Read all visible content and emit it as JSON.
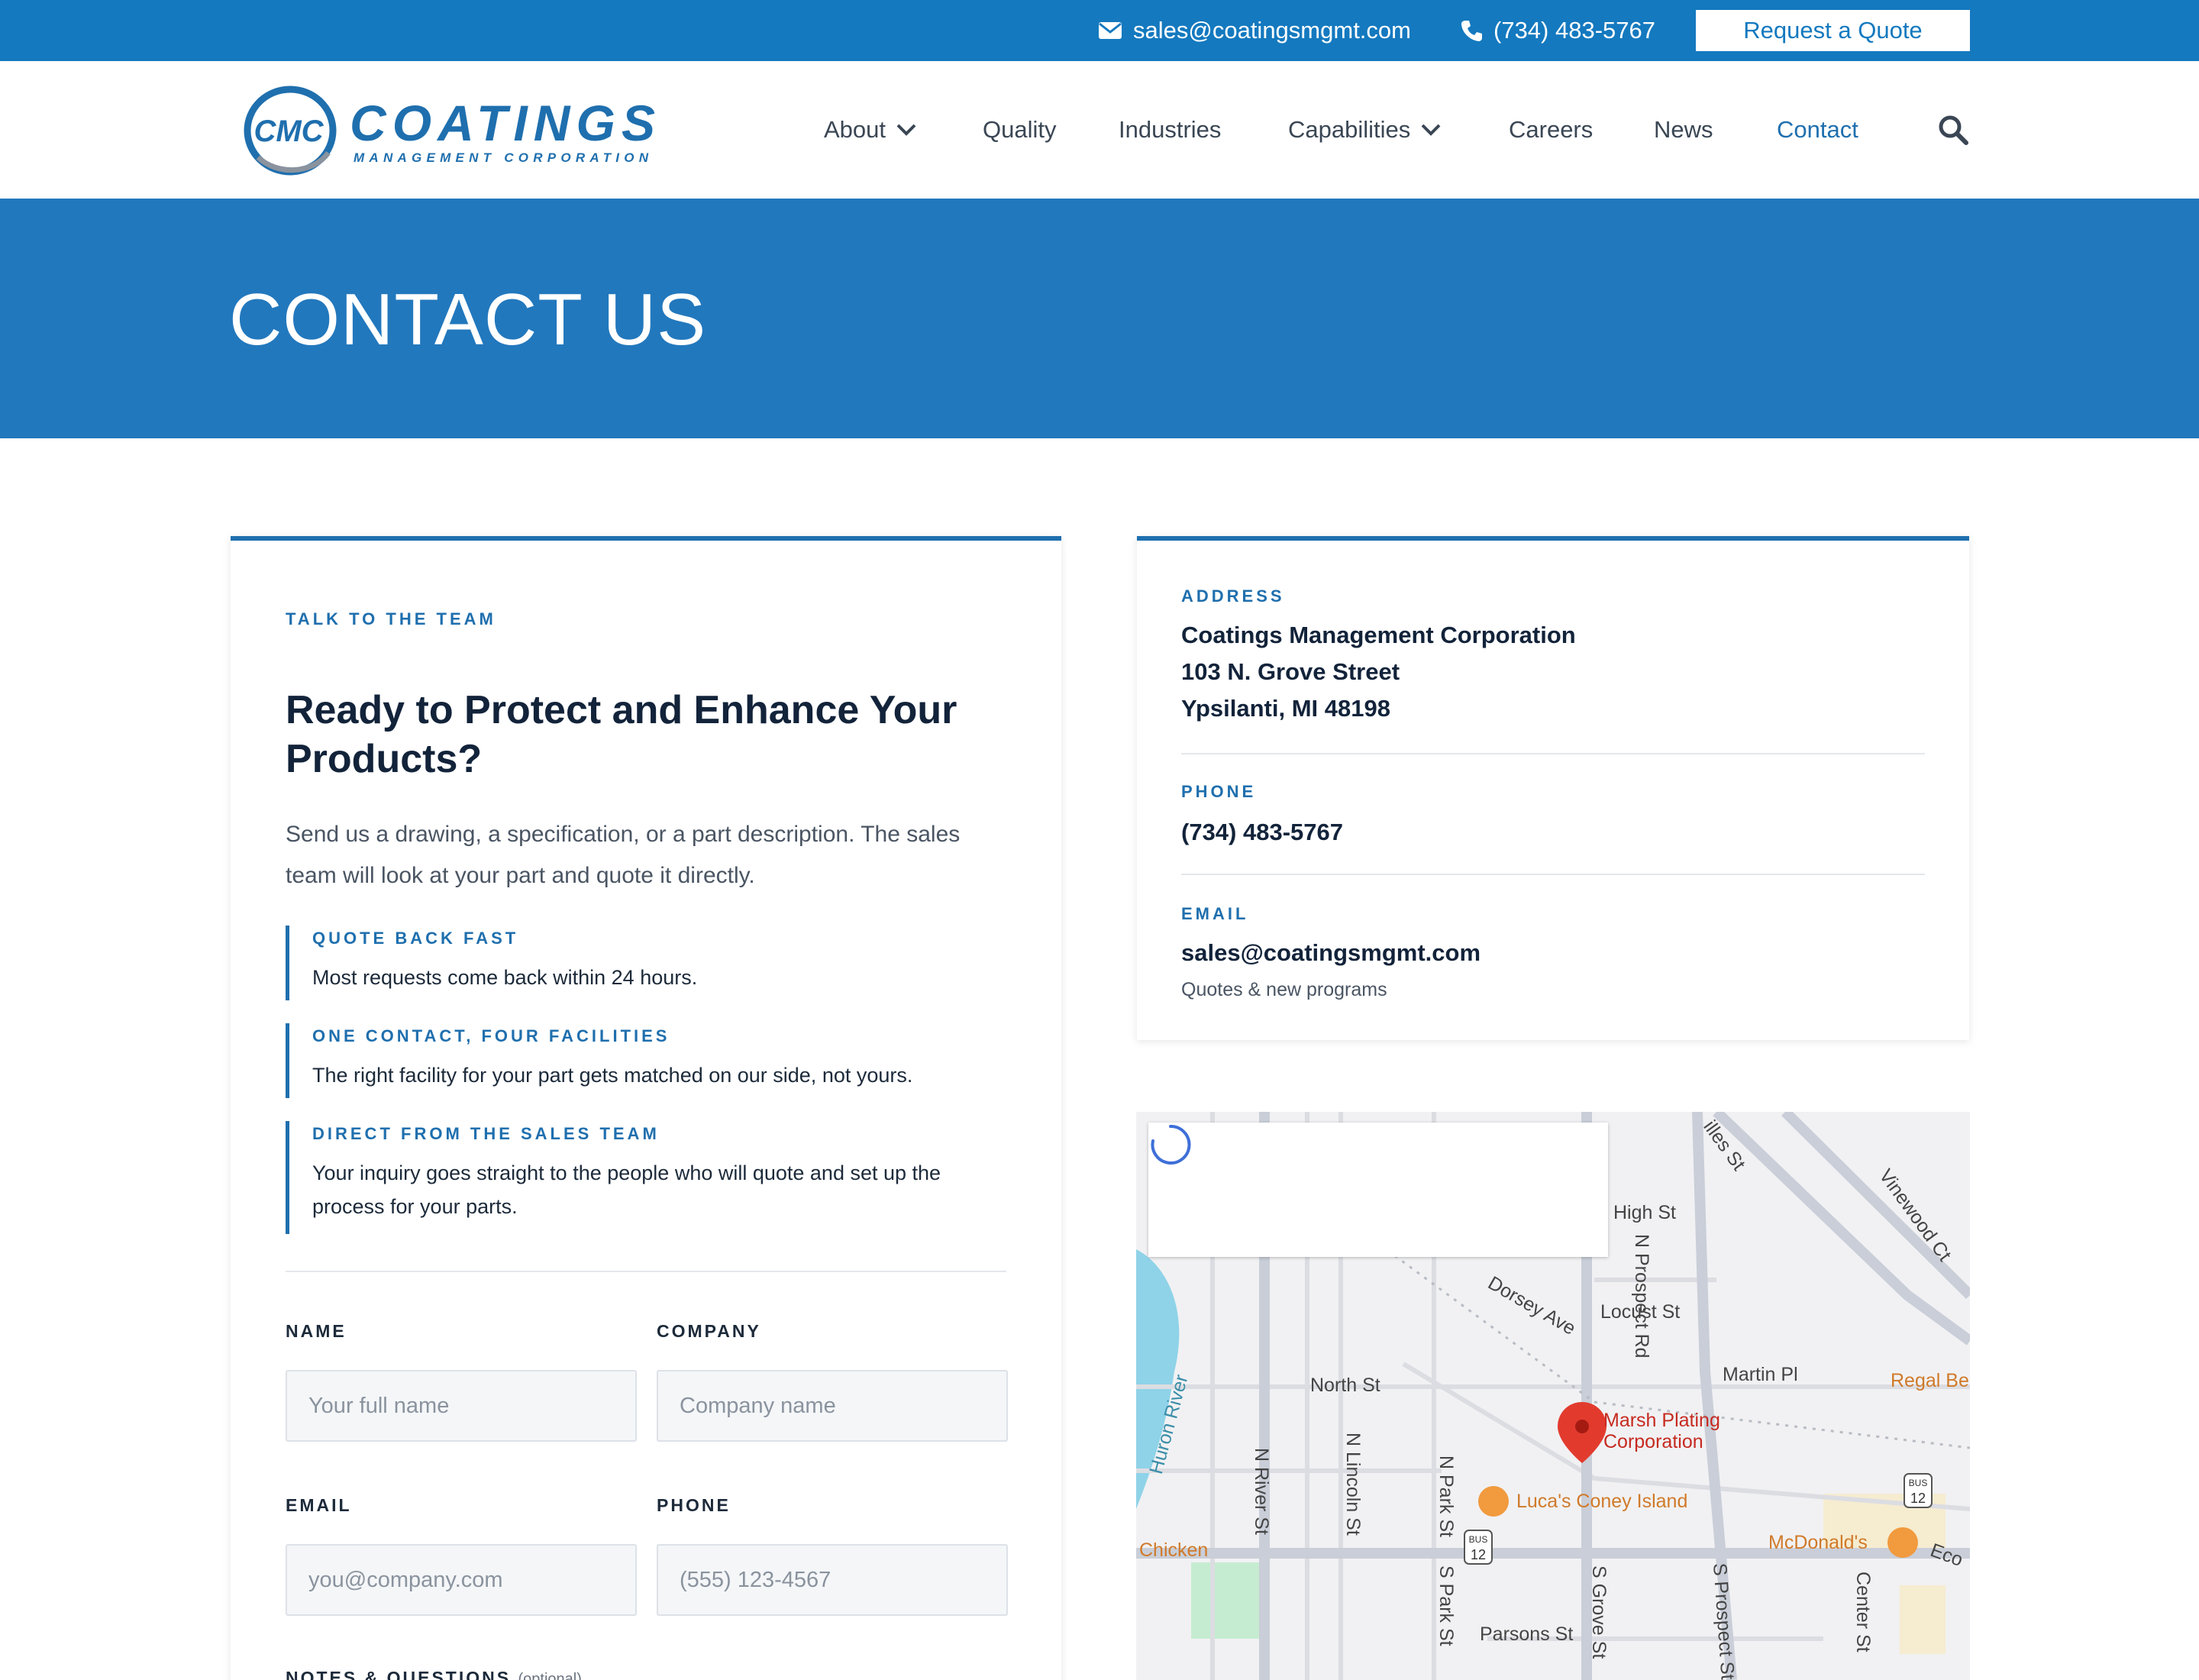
{
  "topbar": {
    "email": "sales@coatingsmgmt.com",
    "phone": "(734) 483-5767",
    "quote_button": "Request a Quote"
  },
  "brand": {
    "logo_mark": "CMC",
    "logo_name": "COATINGS",
    "logo_tagline": "MANAGEMENT CORPORATION"
  },
  "nav": {
    "items": [
      {
        "label": "About",
        "dropdown": true
      },
      {
        "label": "Quality"
      },
      {
        "label": "Industries"
      },
      {
        "label": "Capabilities",
        "dropdown": true
      },
      {
        "label": "Careers"
      },
      {
        "label": "News"
      },
      {
        "label": "Contact",
        "active": true
      }
    ]
  },
  "hero": {
    "title": "CONTACT US"
  },
  "contact_card": {
    "eyebrow": "TALK TO THE TEAM",
    "heading": "Ready to Protect and Enhance Your Products?",
    "intro": "Send us a drawing, a specification, or a part description. The sales team will look at your part and quote it directly.",
    "features": [
      {
        "title": "QUOTE BACK FAST",
        "text": "Most requests come back within 24 hours."
      },
      {
        "title": "ONE CONTACT, FOUR FACILITIES",
        "text": "The right facility for your part gets matched on our side, not yours."
      },
      {
        "title": "DIRECT FROM THE SALES TEAM",
        "text": "Your inquiry goes straight to the people who will quote and set up the process for your parts."
      }
    ],
    "form": {
      "name_label": "NAME",
      "name_placeholder": "Your full name",
      "company_label": "COMPANY",
      "company_placeholder": "Company name",
      "email_label": "EMAIL",
      "email_placeholder": "you@company.com",
      "phone_label": "PHONE",
      "phone_placeholder": "(555) 123-4567",
      "notes_label": "NOTES & QUESTIONS",
      "notes_optional": "(optional)"
    }
  },
  "info_card": {
    "address_label": "ADDRESS",
    "address_line1": "Coatings Management Corporation",
    "address_line2": "103 N. Grove Street",
    "address_line3": "Ypsilanti, MI 48198",
    "phone_label": "PHONE",
    "phone_value": "(734) 483-5767",
    "email_label": "EMAIL",
    "email_value": "sales@coatingsmgmt.com",
    "email_note": "Quotes & new programs"
  },
  "map": {
    "streets": [
      "High St",
      "N Prospect Rd",
      "Dorsey Ave",
      "Locust St",
      "Martin Pl",
      "North St",
      "Huron River",
      "N River St",
      "N Lincoln St",
      "N Park St",
      "S Park St",
      "S Grove St",
      "S Prospect St",
      "Parsons St",
      "Center St",
      "Vinewood Ct",
      "illes St",
      "Regal Be",
      "Chicken",
      "Eco"
    ],
    "pin_label_1": "Marsh Plating",
    "pin_label_2": "Corporation",
    "poi_1": "Luca's Coney Island",
    "poi_2": "McDonald's",
    "shield": "12",
    "shield_bus": "BUS"
  }
}
